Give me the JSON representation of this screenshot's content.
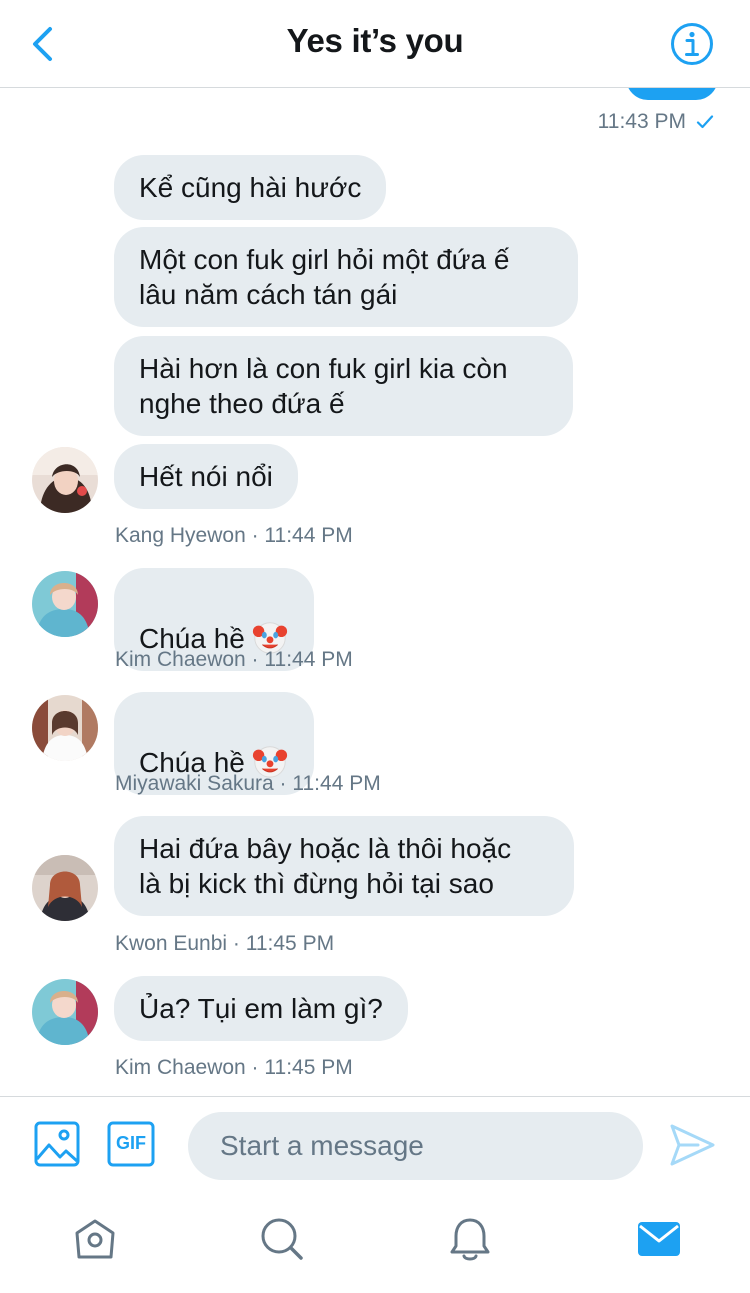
{
  "header": {
    "title": "Yes it’s you",
    "back_icon": "chevron-left-icon",
    "info_icon": "info-icon"
  },
  "colors": {
    "accent": "#1da1f2",
    "bubble_bg": "#e6ecf0",
    "meta_text": "#657786"
  },
  "sent": {
    "time": "11:43 PM",
    "status_icon": "read-check-icon"
  },
  "bubbles": [
    {
      "text": "Kể cũng hài hước"
    },
    {
      "text": "Một con fuk girl hỏi một đứa ế\nlâu năm cách tán gái"
    },
    {
      "text": "Hài hơn là con fuk girl kia còn\nnghe theo đứa ế"
    },
    {
      "text": "Hết nói nổi"
    },
    {
      "text": "Chúa hề",
      "emoji": "clown-face"
    },
    {
      "text": "Chúa hề",
      "emoji": "clown-face"
    },
    {
      "text": "Hai đứa bây hoặc là thôi hoặc\nlà bị kick thì đừng hỏi tại sao"
    },
    {
      "text": "Ủa? Tụi em làm gì?"
    }
  ],
  "meta": [
    "Kang Hyewon · 11:44 PM",
    "Kim Chaewon · 11:44 PM",
    "Miyawaki Sakura · 11:44 PM",
    "Kwon Eunbi · 11:45 PM",
    "Kim Chaewon · 11:45 PM"
  ],
  "composer": {
    "placeholder": "Start a message",
    "media_icon": "image-icon",
    "gif_label": "GIF",
    "send_icon": "send-icon"
  },
  "tabbar": {
    "tabs": [
      "home-icon",
      "search-icon",
      "notifications-icon",
      "messages-icon"
    ],
    "active": "messages-icon"
  }
}
